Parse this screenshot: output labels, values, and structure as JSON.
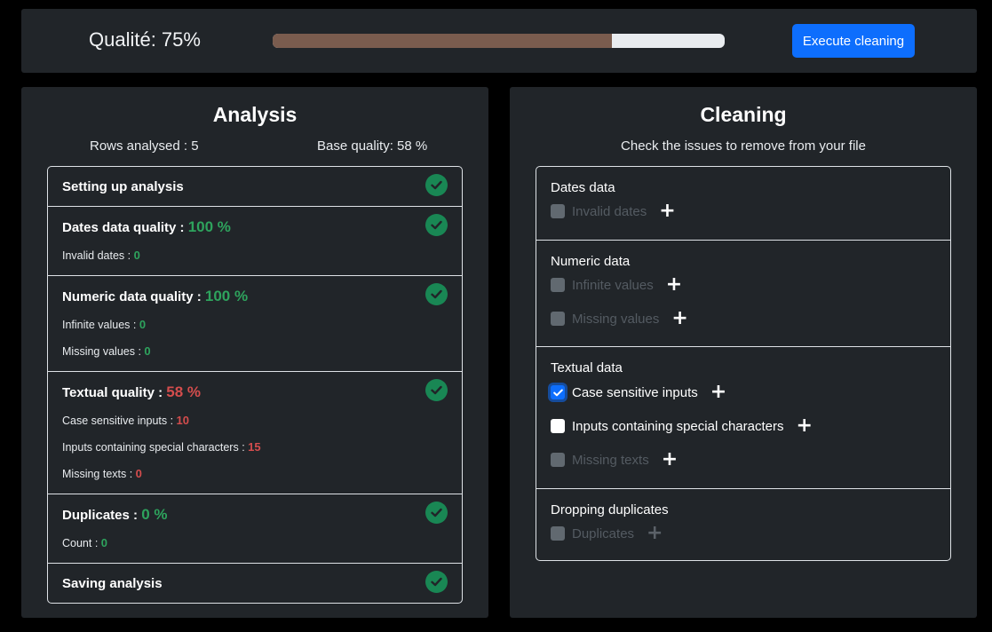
{
  "header": {
    "quality_label": "Qualité: 75%",
    "progress_percent": 75,
    "progress_color": "#7a5c4e",
    "execute_label": "Execute cleaning",
    "execute_color": "#0d6efd"
  },
  "analysis": {
    "title": "Analysis",
    "rows_analysed": "Rows analysed : 5",
    "base_quality": "Base quality: 58 %",
    "sections": {
      "setup": {
        "title": "Setting up analysis"
      },
      "dates": {
        "title": "Dates data quality : ",
        "pct": "100 %",
        "details": [
          {
            "label": "Invalid dates : ",
            "value": "0"
          }
        ]
      },
      "numeric": {
        "title": "Numeric data quality : ",
        "pct": "100 %",
        "details": [
          {
            "label": "Infinite values : ",
            "value": "0"
          },
          {
            "label": "Missing values : ",
            "value": "0"
          }
        ]
      },
      "textual": {
        "title": "Textual quality : ",
        "pct": "58 %",
        "details": [
          {
            "label": "Case sensitive inputs : ",
            "value": "10"
          },
          {
            "label": "Inputs containing special characters : ",
            "value": "15"
          },
          {
            "label": "Missing texts : ",
            "value": "0"
          }
        ]
      },
      "duplicates": {
        "title": "Duplicates : ",
        "pct": "0 %",
        "details": [
          {
            "label": "Count : ",
            "value": "0"
          }
        ]
      },
      "saving": {
        "title": "Saving analysis"
      }
    }
  },
  "cleaning": {
    "title": "Cleaning",
    "subtitle": "Check the issues to remove from your file",
    "groups": {
      "dates": {
        "title": "Dates data",
        "options": [
          {
            "label": "Invalid dates",
            "state": "disabled"
          }
        ]
      },
      "numeric": {
        "title": "Numeric data",
        "options": [
          {
            "label": "Infinite values",
            "state": "disabled"
          },
          {
            "label": "Missing values",
            "state": "disabled"
          }
        ]
      },
      "textual": {
        "title": "Textual data",
        "options": [
          {
            "label": "Case sensitive inputs",
            "state": "checked"
          },
          {
            "label": "Inputs containing special characters",
            "state": "unchecked"
          },
          {
            "label": "Missing texts",
            "state": "disabled"
          }
        ]
      },
      "duplicates": {
        "title": "Dropping duplicates",
        "options": [
          {
            "label": "Duplicates",
            "state": "disabled"
          }
        ]
      }
    }
  },
  "icons": {
    "status": "check-circle-icon",
    "add": "plus-icon",
    "checkbox_tick": "check-icon"
  }
}
